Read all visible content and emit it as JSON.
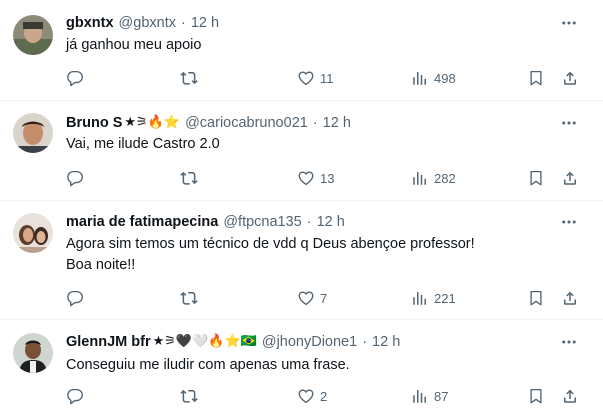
{
  "replies": [
    {
      "name": "gbxntx",
      "name_emojis": "",
      "handle": "@gbxntx",
      "time": "12 h",
      "text_lines": [
        "já ganhou meu apoio"
      ],
      "counts": {
        "reply": "",
        "retweet": "",
        "like": "11",
        "views": "498"
      }
    },
    {
      "name": "Bruno S",
      "name_emojis": "★⚞🔥⭐",
      "handle": "@cariocabruno021",
      "time": "12 h",
      "text_lines": [
        "Vai, me ilude Castro 2.0"
      ],
      "counts": {
        "reply": "",
        "retweet": "",
        "like": "13",
        "views": "282"
      }
    },
    {
      "name": "maria de fatimapecina",
      "name_emojis": "",
      "handle": "@ftpcna135",
      "time": "12 h",
      "text_lines": [
        "Agora sim temos um técnico de vdd q Deus abençoe professor!",
        "Boa noite!!"
      ],
      "counts": {
        "reply": "",
        "retweet": "",
        "like": "7",
        "views": "221"
      }
    },
    {
      "name": "GlennJM bfr",
      "name_emojis": "★⚞🖤🤍🔥⭐🇧🇷",
      "handle": "@jhonyDione1",
      "time": "12 h",
      "text_lines": [
        "Conseguiu me iludir com apenas uma frase."
      ],
      "counts": {
        "reply": "",
        "retweet": "",
        "like": "2",
        "views": "87"
      }
    }
  ],
  "separator": "·",
  "icons": [
    "more-icon",
    "reply-icon",
    "retweet-icon",
    "like-icon",
    "views-icon",
    "bookmark-icon",
    "share-icon"
  ],
  "colors": {
    "text": "#0f1419",
    "secondary": "#536471",
    "divider": "#eff3f4"
  }
}
